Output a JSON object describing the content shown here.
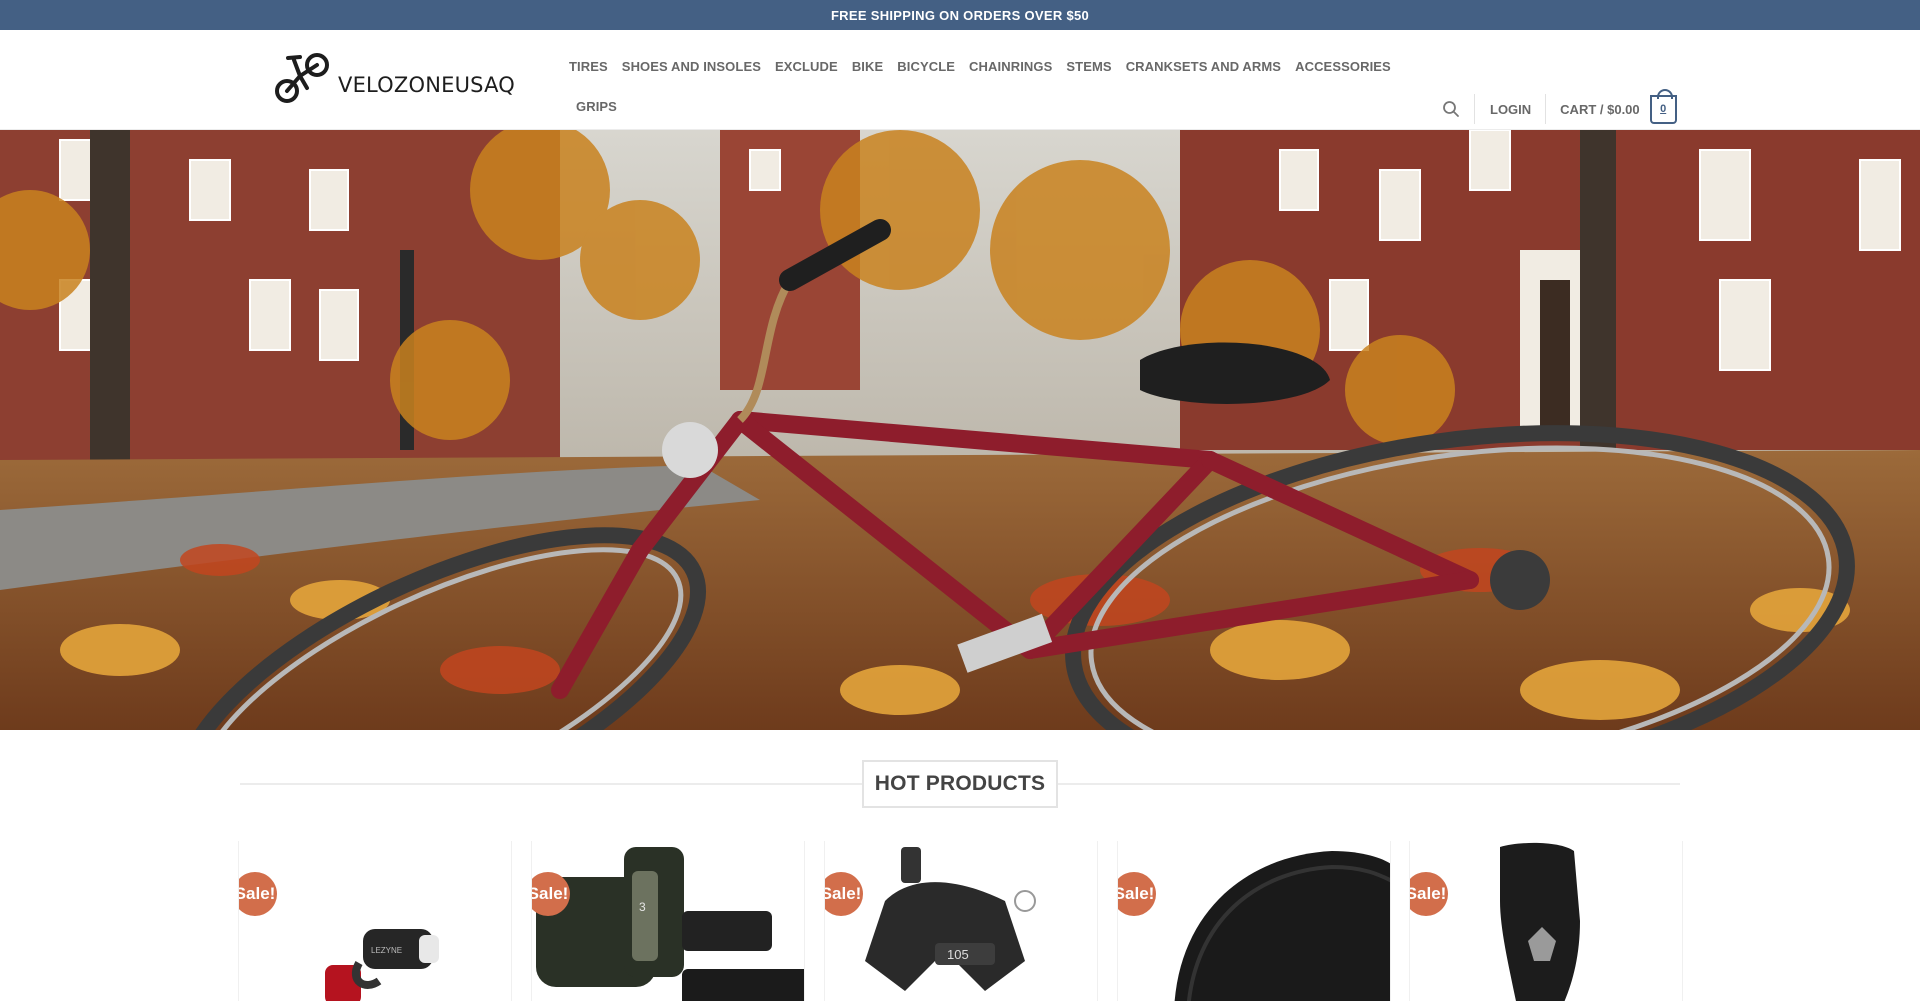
{
  "topbar": {
    "text": "FREE SHIPPING ON ORDERS OVER $50"
  },
  "header": {
    "logo_text": "VELOZONEUSAQ",
    "nav": [
      "TIRES",
      "SHOES AND INSOLES",
      "EXCLUDE",
      "BIKE",
      "BICYCLE",
      "CHAINRINGS",
      "STEMS",
      "CRANKSETS AND ARMS",
      "ACCESSORIES",
      "GRIPS"
    ],
    "login": "LOGIN",
    "cart_label": "CART / $0.00",
    "cart_count": "0"
  },
  "hero": {
    "alt": "Red bicycle lying in autumn leaves"
  },
  "section": {
    "title": "HOT PRODUCTS"
  },
  "products": [
    {
      "badge": "Sale!",
      "image": "bike-light-set"
    },
    {
      "badge": "Sale!",
      "image": "grip-shifter"
    },
    {
      "badge": "Sale!",
      "image": "road-brake-caliper"
    },
    {
      "badge": "Sale!",
      "image": "road-tire"
    },
    {
      "badge": "Sale!",
      "image": "knee-guard"
    }
  ],
  "colors": {
    "primary": "#446084",
    "sale": "#d26e4b",
    "nav_text": "#686868"
  }
}
